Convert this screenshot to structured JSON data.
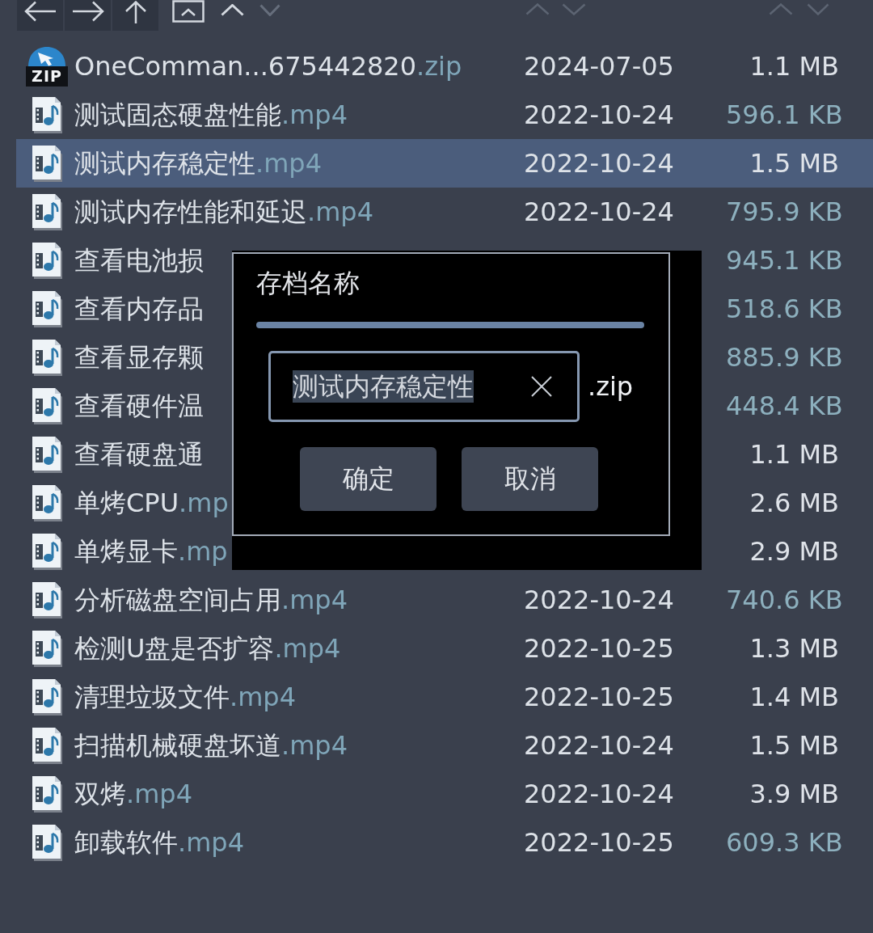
{
  "toolbar": {
    "buttons": [
      {
        "kind": "back",
        "disabled": false
      },
      {
        "kind": "forward",
        "disabled": false
      },
      {
        "kind": "up",
        "disabled": false
      },
      {
        "kind": "collapse",
        "disabled": false
      },
      {
        "kind": "scroll_up",
        "disabled": false
      },
      {
        "kind": "scroll_down",
        "disabled": true
      }
    ]
  },
  "files": [
    {
      "kind": "archive",
      "icon_label": "ZIP",
      "name": "OneComman...675442820",
      "ext": ".zip",
      "date": "2024-07-05",
      "size": {
        "text": "1.1 MB",
        "color": "#dfe3e9"
      },
      "selected": false
    },
    {
      "kind": "video",
      "name": "测试固态硬盘性能",
      "ext": ".mp4",
      "date": "2022-10-24",
      "size": {
        "text": "596.1 KB",
        "color": "#8db0be"
      },
      "selected": false
    },
    {
      "kind": "video",
      "name": "测试内存稳定性",
      "ext": ".mp4",
      "date": "2022-10-24",
      "size": {
        "text": "1.5 MB",
        "color": "#dfe3e9"
      },
      "selected": true
    },
    {
      "kind": "video",
      "name": "测试内存性能和延迟",
      "ext": ".mp4",
      "date": "2022-10-24",
      "size": {
        "text": "795.9 KB",
        "color": "#8db0be"
      },
      "selected": false
    },
    {
      "kind": "video",
      "name": "查看电池损",
      "size": {
        "text": "945.1 KB",
        "color": "#8db0be"
      },
      "selected": false
    },
    {
      "kind": "video",
      "name": "查看内存品",
      "size": {
        "text": "518.6 KB",
        "color": "#8db0be"
      },
      "selected": false
    },
    {
      "kind": "video",
      "name": "查看显存颗",
      "size": {
        "text": "885.9 KB",
        "color": "#8db0be"
      },
      "selected": false
    },
    {
      "kind": "video",
      "name": "查看硬件温",
      "size": {
        "text": "448.4 KB",
        "color": "#8db0be"
      },
      "selected": false
    },
    {
      "kind": "video",
      "name": "查看硬盘通",
      "size": {
        "text": "1.1 MB",
        "color": "#dfe3e9"
      },
      "selected": false
    },
    {
      "kind": "video",
      "name": "单烤CPU",
      "ext": ".mp",
      "size": {
        "text": "2.6 MB",
        "color": "#dfe3e9"
      },
      "selected": false
    },
    {
      "kind": "video",
      "name": "单烤显卡",
      "ext": ".mp",
      "size": {
        "text": "2.9 MB",
        "color": "#dfe3e9"
      },
      "selected": false
    },
    {
      "kind": "video",
      "name": "分析磁盘空间占用",
      "ext": ".mp4",
      "date": "2022-10-24",
      "size": {
        "text": "740.6 KB",
        "color": "#8db0be"
      },
      "selected": false
    },
    {
      "kind": "video",
      "name": "检测U盘是否扩容",
      "ext": ".mp4",
      "date": "2022-10-25",
      "size": {
        "text": "1.3 MB",
        "color": "#dfe3e9"
      },
      "selected": false
    },
    {
      "kind": "video",
      "name": "清理垃圾文件",
      "ext": ".mp4",
      "date": "2022-10-25",
      "size": {
        "text": "1.4 MB",
        "color": "#dfe3e9"
      },
      "selected": false
    },
    {
      "kind": "video",
      "name": "扫描机械硬盘坏道",
      "ext": ".mp4",
      "date": "2022-10-24",
      "size": {
        "text": "1.5 MB",
        "color": "#dfe3e9"
      },
      "selected": false
    },
    {
      "kind": "video",
      "name": "双烤",
      "ext": ".mp4",
      "date": "2022-10-24",
      "size": {
        "text": "3.9 MB",
        "color": "#dfe3e9"
      },
      "selected": false
    },
    {
      "kind": "video",
      "name": "卸载软件",
      "ext": ".mp4",
      "date": "2022-10-25",
      "size": {
        "text": "609.3 KB",
        "color": "#8db0be"
      },
      "selected": false
    }
  ],
  "dialog": {
    "title": "存档名称",
    "field": {
      "value": "测试内存稳定性",
      "value_selected": true
    },
    "suffix": ".zip",
    "buttons": [
      {
        "label": "确定"
      },
      {
        "label": "取消"
      }
    ]
  }
}
